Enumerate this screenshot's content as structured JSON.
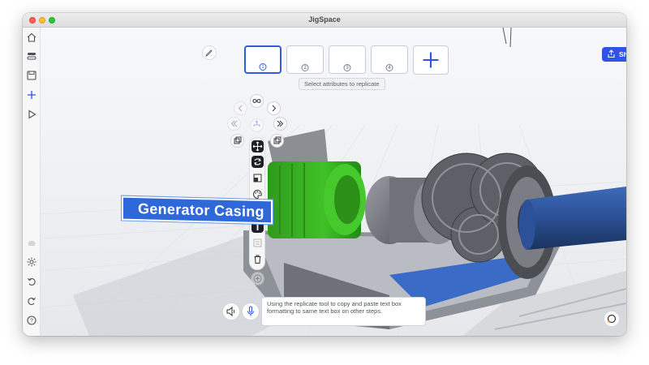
{
  "window": {
    "title": "JigSpace"
  },
  "sidebar": {
    "top_icons": [
      "home-icon",
      "toggle-icon",
      "save-icon",
      "add-icon",
      "play-icon"
    ],
    "bottom_icons": [
      "cloud-icon",
      "gear-icon",
      "undo-icon",
      "redo-icon",
      "help-circle-icon",
      "more-icon"
    ]
  },
  "steps": {
    "items": [
      {
        "number": "1",
        "active": true
      },
      {
        "number": "2",
        "active": false
      },
      {
        "number": "3",
        "active": false
      },
      {
        "number": "4",
        "active": false
      }
    ],
    "add_icon": "plus-icon",
    "hint": "Select attributes to replicate"
  },
  "share": {
    "label": "Share",
    "icon": "share-icon"
  },
  "object_label": {
    "text": "Generator Casing",
    "color": "#2f68d8"
  },
  "step_text": {
    "value": "Using the replicate tool to copy and paste text box formatting to same text box on other steps."
  },
  "colors": {
    "accent": "#2f53e6",
    "active_tool": "#1e1f22"
  }
}
